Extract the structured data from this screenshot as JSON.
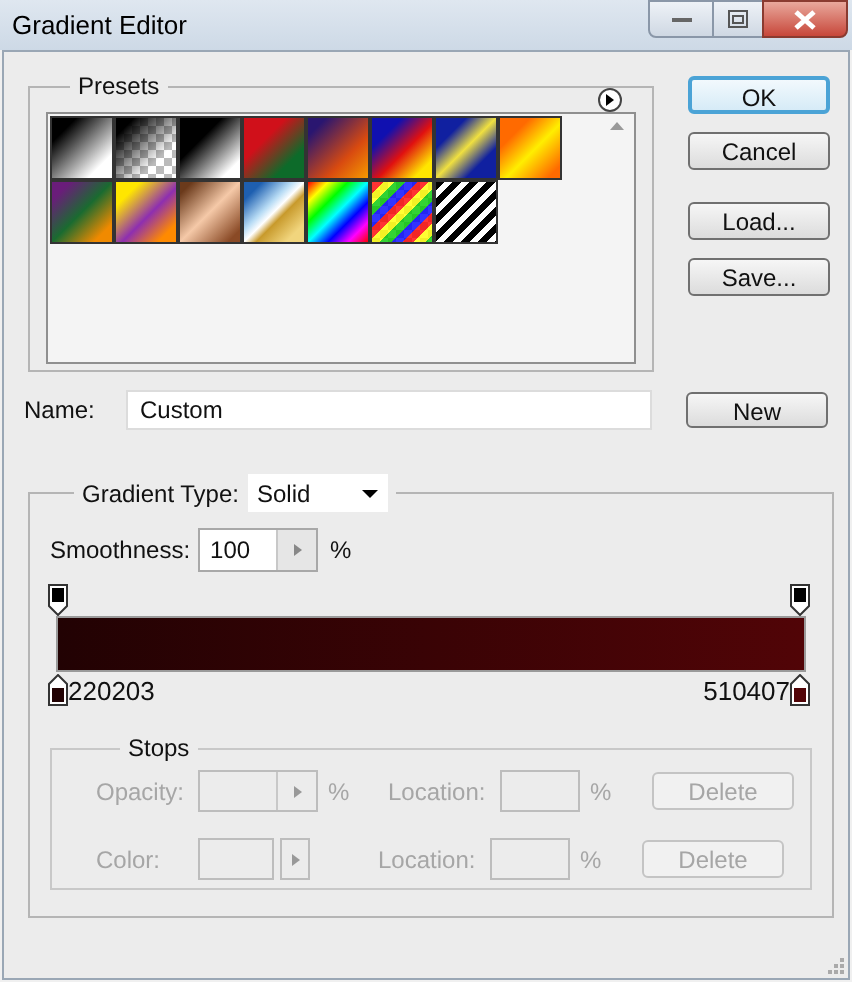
{
  "window": {
    "title": "Gradient Editor"
  },
  "presets": {
    "label": "Presets"
  },
  "buttons": [
    {
      "label": "OK",
      "default": true
    },
    {
      "label": "Cancel",
      "default": false
    },
    {
      "label": "Load...",
      "default": false
    },
    {
      "label": "Save...",
      "default": false
    }
  ],
  "name_row": {
    "label": "Name:",
    "value": "Custom",
    "button": "New"
  },
  "gradient": {
    "type_label": "Gradient Type:",
    "type_value": "Solid",
    "smoothness_label": "Smoothness:",
    "smoothness_value": "100",
    "smoothness_unit": "%",
    "opacity_stops": [
      {
        "kind": "opacity"
      },
      {
        "kind": "opacity"
      }
    ],
    "color_stops": [
      {
        "label": "220203",
        "color": "#220203"
      },
      {
        "label": "510407",
        "color": "#510407"
      }
    ]
  },
  "stops": {
    "label": "Stops",
    "disabled": true,
    "rows": [
      {
        "kind": "stepper",
        "label": "Opacity:",
        "unit": "%",
        "location_label": "Location:",
        "location_unit": "%",
        "button": "Delete"
      },
      {
        "kind": "swatch",
        "label": "Color:",
        "location_label": "Location:",
        "location_unit": "%",
        "button": "Delete"
      }
    ]
  }
}
